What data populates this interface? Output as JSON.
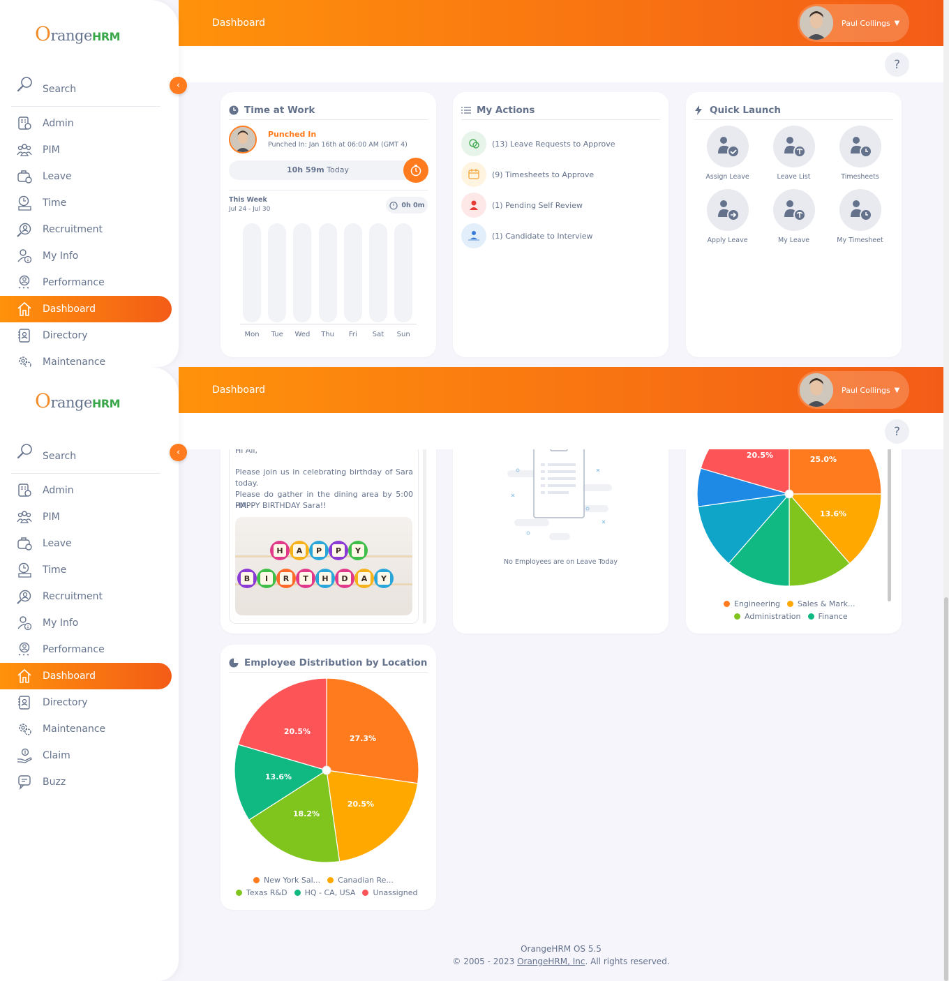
{
  "app": {
    "logo_o": "O",
    "logo_range": "range",
    "logo_hrm": "HRM"
  },
  "topbar": {
    "page_title": "Dashboard",
    "user_name": "Paul Collings",
    "help": "?"
  },
  "sidebar": {
    "search_label": "Search",
    "items": [
      {
        "label": "Admin",
        "icon": "admin-icon"
      },
      {
        "label": "PIM",
        "icon": "pim-icon"
      },
      {
        "label": "Leave",
        "icon": "leave-icon"
      },
      {
        "label": "Time",
        "icon": "time-icon"
      },
      {
        "label": "Recruitment",
        "icon": "recruitment-icon"
      },
      {
        "label": "My Info",
        "icon": "my-info-icon"
      },
      {
        "label": "Performance",
        "icon": "performance-icon"
      },
      {
        "label": "Dashboard",
        "icon": "home-icon",
        "active": true
      },
      {
        "label": "Directory",
        "icon": "directory-icon"
      },
      {
        "label": "Maintenance",
        "icon": "maintenance-icon"
      },
      {
        "label": "Claim",
        "icon": "claim-icon"
      },
      {
        "label": "Buzz",
        "icon": "buzz-icon"
      }
    ]
  },
  "time_at_work": {
    "title": "Time at Work",
    "status": "Punched In",
    "punched_in": "Punched In: Jan 16th at 06:00 AM (GMT 4)",
    "duration": "10h 59m",
    "duration_suffix": "Today",
    "week_label": "This Week",
    "week_range": "Jul 24 - Jul 30",
    "week_total": "0h 0m",
    "days": [
      "Mon",
      "Tue",
      "Wed",
      "Thu",
      "Fri",
      "Sat",
      "Sun"
    ]
  },
  "my_actions": {
    "title": "My Actions",
    "items": [
      {
        "label": "(13) Leave Requests to Approve",
        "color": "#e6f4ea"
      },
      {
        "label": "(9) Timesheets to Approve",
        "color": "#fff4e0"
      },
      {
        "label": "(1) Pending Self Review",
        "color": "#fde7e7"
      },
      {
        "label": "(1) Candidate to Interview",
        "color": "#e3eefb"
      }
    ]
  },
  "quick_launch": {
    "title": "Quick Launch",
    "items": [
      {
        "label": "Assign Leave",
        "icon": "assign-leave-icon"
      },
      {
        "label": "Leave List",
        "icon": "leave-list-icon"
      },
      {
        "label": "Timesheets",
        "icon": "timesheets-icon"
      },
      {
        "label": "Apply Leave",
        "icon": "apply-leave-icon"
      },
      {
        "label": "My Leave",
        "icon": "my-leave-icon"
      },
      {
        "label": "My Timesheet",
        "icon": "my-timesheet-icon"
      }
    ]
  },
  "buzz": {
    "greeting": "Hi All,",
    "line1": "Please join us in celebrating birthday of Sara today.",
    "line2": "Please do gather in the dining area by 5:00 PM.",
    "line3": "HAPPY BIRTHDAY Sara!!",
    "cupcake_row1": [
      "H",
      "A",
      "P",
      "P",
      "Y"
    ],
    "cupcake_row2": [
      "B",
      "I",
      "R",
      "T",
      "H",
      "D",
      "A",
      "Y"
    ]
  },
  "leave_today": {
    "empty_text": "No Employees are on Leave Today"
  },
  "colors": {
    "orange": "#ff7b1d",
    "amber": "#ffa800",
    "lime": "#7fc51e",
    "green": "#10b981",
    "teal": "#0ea5c8",
    "blue": "#1e8ae6",
    "red": "#fd5457"
  },
  "chart_data": [
    {
      "type": "pie",
      "values_known": [
        25.0,
        13.6,
        20.5
      ],
      "slices": [
        {
          "name": "Engineering",
          "value": 25.0,
          "color": "#ff7b1d"
        },
        {
          "name": "Sales & Mark...",
          "value": 13.6,
          "color": "#ffa800"
        },
        {
          "name": "Administration",
          "value": 11.4,
          "color": "#7fc51e"
        },
        {
          "name": "Finance",
          "value": 11.4,
          "color": "#10b981"
        },
        {
          "name": "",
          "value": 11.4,
          "color": "#0ea5c8"
        },
        {
          "name": "",
          "value": 6.7,
          "color": "#1e8ae6"
        },
        {
          "name": "",
          "value": 20.5,
          "color": "#fd5457"
        }
      ],
      "labels": [
        "25.0%",
        "13.6%",
        "20.5%"
      ],
      "legend": [
        "Engineering",
        "Sales & Mark...",
        "Administration",
        "Finance"
      ]
    },
    {
      "type": "pie",
      "title": "Employee Distribution by Location",
      "slices": [
        {
          "name": "New York Sal...",
          "value": 27.3,
          "color": "#ff7b1d"
        },
        {
          "name": "Canadian Re...",
          "value": 20.5,
          "color": "#ffa800"
        },
        {
          "name": "Texas R&D",
          "value": 18.2,
          "color": "#7fc51e"
        },
        {
          "name": "HQ - CA, USA",
          "value": 13.6,
          "color": "#10b981"
        },
        {
          "name": "Unassigned",
          "value": 20.5,
          "color": "#fd5457"
        }
      ],
      "labels": [
        "27.3%",
        "20.5%",
        "18.2%",
        "13.6%",
        "20.5%"
      ],
      "legend": [
        "New York Sal...",
        "Canadian Re...",
        "Texas R&D",
        "HQ - CA, USA",
        "Unassigned"
      ]
    }
  ],
  "footer": {
    "version": "OrangeHRM OS 5.5",
    "copyright_prefix": "© 2005 - 2023",
    "company": "OrangeHRM, Inc",
    "rights": ". All rights reserved."
  }
}
